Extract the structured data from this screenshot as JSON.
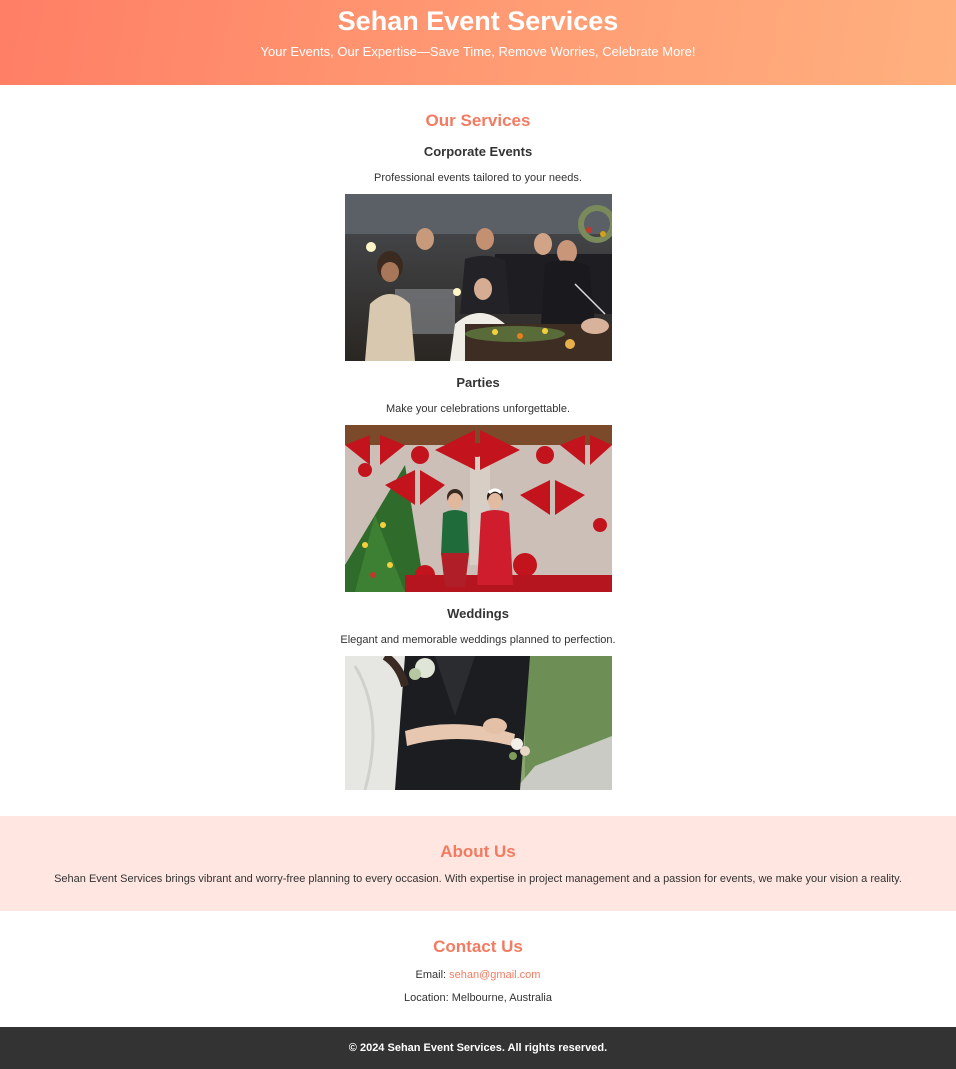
{
  "header": {
    "title": "Sehan Event Services",
    "tagline": "Your Events, Our Expertise—Save Time, Remove Worries, Celebrate More!"
  },
  "services": {
    "title": "Our Services",
    "items": [
      {
        "name": "Corporate Events",
        "description": "Professional events tailored to your needs."
      },
      {
        "name": "Parties",
        "description": "Make your celebrations unforgettable."
      },
      {
        "name": "Weddings",
        "description": "Elegant and memorable weddings planned to perfection."
      }
    ]
  },
  "about": {
    "title": "About Us",
    "text": "Sehan Event Services brings vibrant and worry-free planning to every occasion. With expertise in project management and a passion for events, we make your vision a reality."
  },
  "contact": {
    "title": "Contact Us",
    "email_label": "Email:",
    "email": "sehan@gmail.com",
    "location_label": "Location:",
    "location": "Melbourne, Australia"
  },
  "footer": {
    "text": "© 2024 Sehan Event Services. All rights reserved."
  },
  "colors": {
    "accent": "#f27b62",
    "about_bg": "#ffe6e0",
    "footer_bg": "#333333"
  }
}
